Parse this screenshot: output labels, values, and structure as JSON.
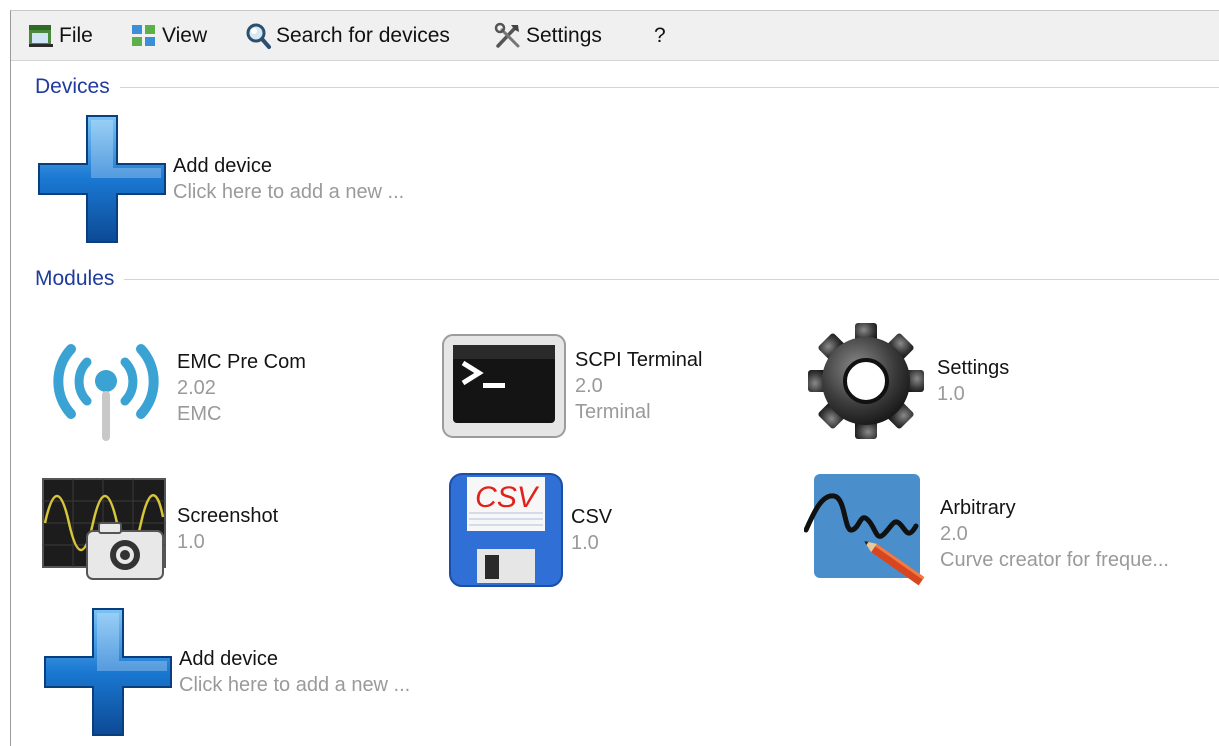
{
  "menu": {
    "file": {
      "label": "File",
      "icon": "file-icon"
    },
    "view": {
      "label": "View",
      "icon": "view-grid-icon"
    },
    "search": {
      "label": "Search for devices",
      "icon": "magnifier-icon"
    },
    "settings": {
      "label": "Settings",
      "icon": "tools-icon"
    },
    "help": {
      "label": "?"
    }
  },
  "sections": {
    "devices": "Devices",
    "modules": "Modules"
  },
  "devices": [
    {
      "name": "Add device",
      "description": "Click here to add a new ...",
      "icon": "plus-icon"
    }
  ],
  "modules": [
    {
      "name": "EMC Pre Com",
      "version": "2.02",
      "category": "EMC",
      "icon": "wireless-antenna-icon"
    },
    {
      "name": "SCPI Terminal",
      "version": "2.0",
      "category": "Terminal",
      "icon": "terminal-icon"
    },
    {
      "name": "Settings",
      "version": "1.0",
      "icon": "gear-icon"
    },
    {
      "name": "Screenshot",
      "version": "1.0",
      "icon": "oscilloscope-camera-icon"
    },
    {
      "name": "CSV",
      "version": "1.0",
      "icon": "csv-floppy-icon",
      "icon_text": "CSV"
    },
    {
      "name": "Arbitrary",
      "version": "2.0",
      "category": "Curve creator for freque...",
      "icon": "curve-pencil-icon"
    },
    {
      "name": "Add device",
      "description": "Click here to add a new ...",
      "icon": "plus-icon"
    }
  ],
  "colors": {
    "section_header": "#1f3b9c",
    "secondary_text": "#9a9a9a",
    "plus_blue": "#1a78d2",
    "emc_teal": "#3aa3d3"
  }
}
